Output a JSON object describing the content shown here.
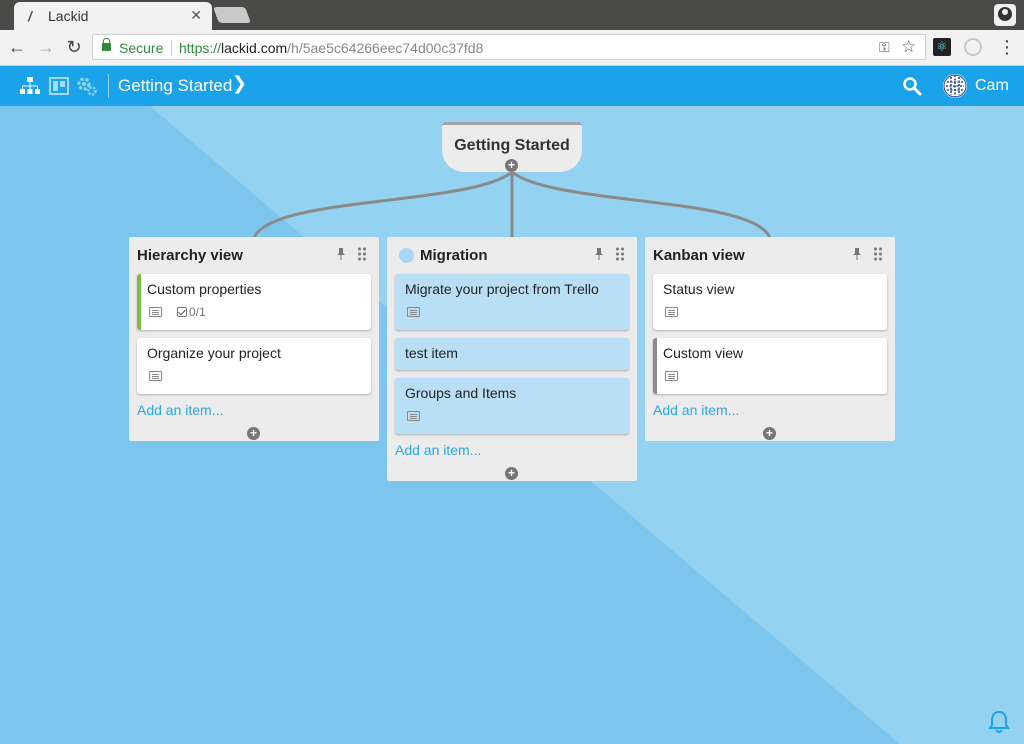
{
  "browser": {
    "tab_title": "Lackid",
    "secure_label": "Secure",
    "url_scheme": "https://",
    "url_host": "lackid.com",
    "url_path": "/h/5ae5c64266eec74d00c37fd8"
  },
  "app": {
    "breadcrumb_title": "Getting Started",
    "user_name": "Cam",
    "accent_color": "#1aa3e8"
  },
  "board": {
    "root_title": "Getting Started",
    "columns": [
      {
        "title": "Hierarchy view",
        "add_label": "Add an item...",
        "cards": [
          {
            "title": "Custom properties",
            "checklist": "0/1",
            "color_bar": "#7ac143"
          },
          {
            "title": "Organize your project"
          }
        ]
      },
      {
        "title": "Migration",
        "add_label": "Add an item...",
        "cards": [
          {
            "title": "Migrate your project from Trello"
          },
          {
            "title": "test item"
          },
          {
            "title": "Groups and Items"
          }
        ]
      },
      {
        "title": "Kanban view",
        "add_label": "Add an item...",
        "cards": [
          {
            "title": "Status view"
          },
          {
            "title": "Custom view",
            "color_bar": "#8c8c8c"
          }
        ]
      }
    ]
  }
}
